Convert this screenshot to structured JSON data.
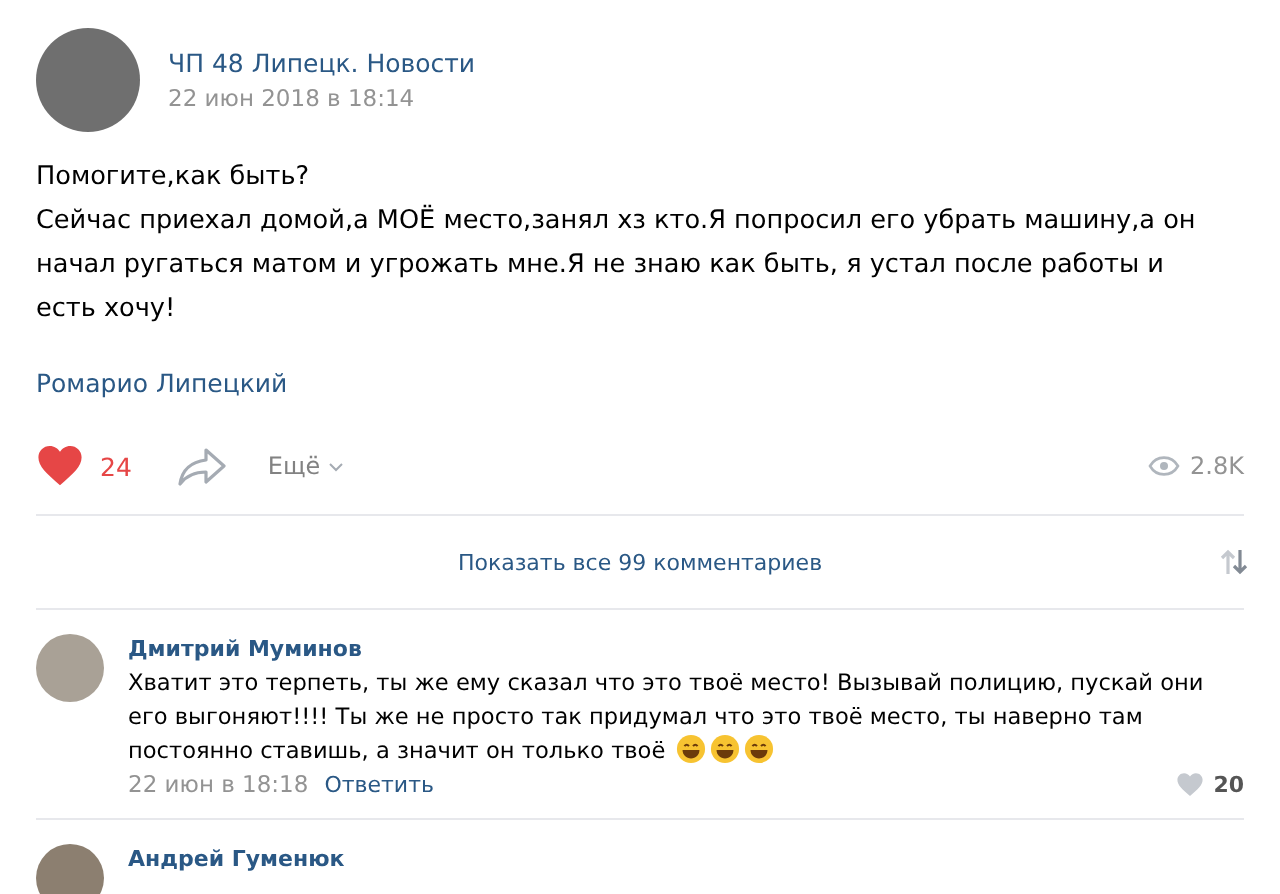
{
  "post": {
    "author": "ЧП 48 Липецк. Новости",
    "date": "22 июн 2018 в 18:14",
    "text": [
      "Помогите,как быть?",
      "Сейчас приехал домой,а МОЁ место,занял хз кто.Я попросил его убрать машину,а он начал ругаться матом и угрожать мне.Я не знаю как быть, я устал после работы и есть хочу!"
    ],
    "signature": "Ромарио Липецкий",
    "likes": {
      "count": "24",
      "liked": true
    },
    "more": "Ещё",
    "views": "2.8K"
  },
  "show_all": "Показать все 99 комментариев",
  "comments": [
    {
      "author": "Дмитрий Муминов",
      "text": "Хватит это терпеть, ты же ему сказал что это твоё место! Вызывай полицию, пускай они его выгоняют!!!! Ты же не просто так придумал что это твоё место, ты наверно там постоянно ставишь, а значит он только твоё",
      "emojis": [
        {
          "kind": "grin"
        },
        {
          "kind": "grin"
        },
        {
          "kind": "grin"
        }
      ],
      "date": "22 июн в 18:18",
      "reply": "Ответить",
      "likes": {
        "count": "20",
        "liked": false
      }
    },
    {
      "author": "Андрей Гуменюк"
    }
  ]
}
